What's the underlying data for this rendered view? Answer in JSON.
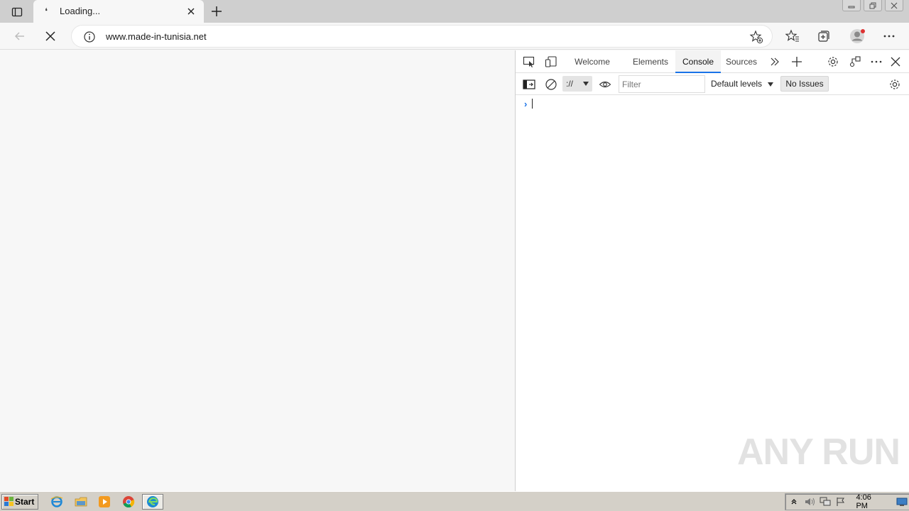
{
  "browser": {
    "tab": {
      "title": "Loading...",
      "favicon": "loading-icon"
    },
    "address": {
      "url": "www.made-in-tunisia.net"
    }
  },
  "devtools": {
    "tabs": [
      {
        "label": "Welcome",
        "active": false
      },
      {
        "label": "Elements",
        "active": false
      },
      {
        "label": "Console",
        "active": true
      },
      {
        "label": "Sources",
        "active": false
      }
    ],
    "toolbar": {
      "context": "://",
      "filter_placeholder": "Filter",
      "levels": "Default levels",
      "issues": "No Issues"
    },
    "console": {
      "prompt": "›"
    }
  },
  "watermark": "ANY RUN",
  "taskbar": {
    "start_label": "Start",
    "clock": "4:06 PM",
    "apps": [
      "ie-icon",
      "explorer-icon",
      "media-player-icon",
      "chrome-icon",
      "edge-icon"
    ]
  },
  "colors": {
    "accent": "#1a73e8",
    "tabstrip": "#cfcfcf",
    "taskbar": "#d4d0c8"
  }
}
